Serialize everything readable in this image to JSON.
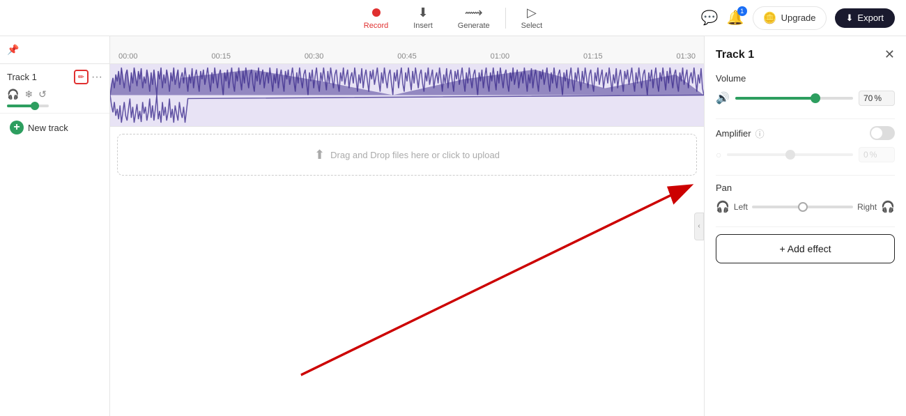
{
  "toolbar": {
    "record_label": "Record",
    "insert_label": "Insert",
    "generate_label": "Generate",
    "select_label": "Select",
    "upgrade_label": "Upgrade",
    "export_label": "Export",
    "notif_count": "1"
  },
  "timeline": {
    "ruler_marks": [
      "00:00",
      "00:15",
      "00:30",
      "00:45",
      "01:00",
      "01:15",
      "01:30"
    ]
  },
  "track": {
    "name": "Track 1",
    "volume_value": "70",
    "volume_unit": "%"
  },
  "new_track_label": "New track",
  "drop_zone_text": "Drag and Drop files here or click to upload",
  "right_panel": {
    "title": "Track 1",
    "volume_label": "Volume",
    "volume_value": "70",
    "volume_unit": "%",
    "amplifier_label": "Amplifier",
    "amp_value": "0",
    "amp_unit": "%",
    "pan_label": "Pan",
    "pan_left": "Left",
    "pan_right": "Right",
    "add_effect_label": "+ Add effect"
  }
}
